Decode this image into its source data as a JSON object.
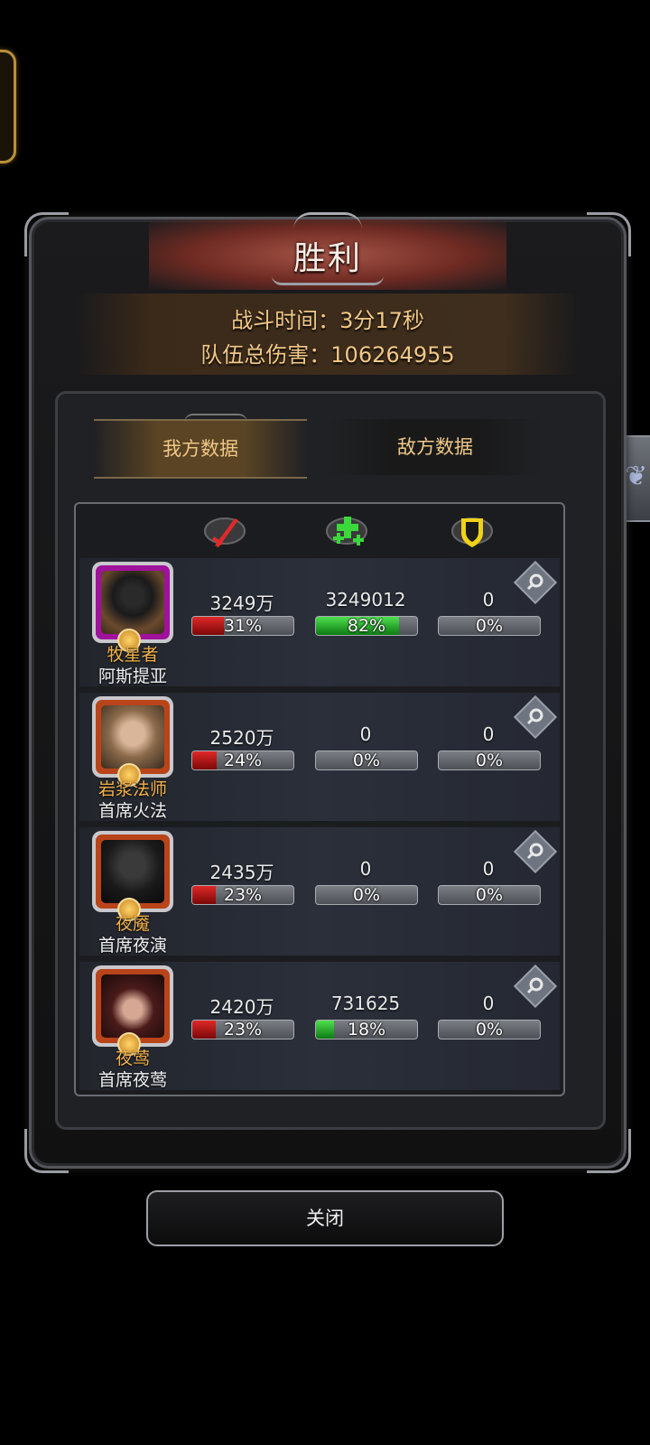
{
  "result": {
    "title": "胜利",
    "battle_time": "战斗时间：3分17秒",
    "total_damage": "队伍总伤害：106264955"
  },
  "tabs": {
    "mine": "我方数据",
    "enemy": "敌方数据",
    "active": "mine"
  },
  "columns": {
    "icons": [
      "sword-icon",
      "heal-plus-icon",
      "shield-icon"
    ]
  },
  "heroes": [
    {
      "class": "牧星者",
      "name": "阿斯提亚",
      "frame": "purple",
      "damage": "3249万",
      "damage_pct": "31%",
      "damage_ratio": 0.31,
      "heal": "3249012",
      "heal_pct": "82%",
      "heal_ratio": 0.82,
      "tank": "0",
      "tank_pct": "0%",
      "tank_ratio": 0
    },
    {
      "class": "岩浆法师",
      "name": "首席火法",
      "frame": "orange",
      "damage": "2520万",
      "damage_pct": "24%",
      "damage_ratio": 0.24,
      "heal": "0",
      "heal_pct": "0%",
      "heal_ratio": 0,
      "tank": "0",
      "tank_pct": "0%",
      "tank_ratio": 0
    },
    {
      "class": "夜魇",
      "name": "首席夜演",
      "frame": "orange",
      "damage": "2435万",
      "damage_pct": "23%",
      "damage_ratio": 0.23,
      "heal": "0",
      "heal_pct": "0%",
      "heal_ratio": 0,
      "tank": "0",
      "tank_pct": "0%",
      "tank_ratio": 0
    },
    {
      "class": "夜莺",
      "name": "首席夜莺",
      "frame": "orange",
      "damage": "2420万",
      "damage_pct": "23%",
      "damage_ratio": 0.23,
      "heal": "731625",
      "heal_pct": "18%",
      "heal_ratio": 0.18,
      "tank": "0",
      "tank_pct": "0%",
      "tank_ratio": 0
    }
  ],
  "close_label": "关闭",
  "colors": {
    "gold_text": "#f0c887",
    "class_text": "#f4b247",
    "damage_bar": "#c81818",
    "heal_bar": "#2fbf32",
    "purple_frame": "#a0119c",
    "orange_frame": "#b9441a"
  }
}
